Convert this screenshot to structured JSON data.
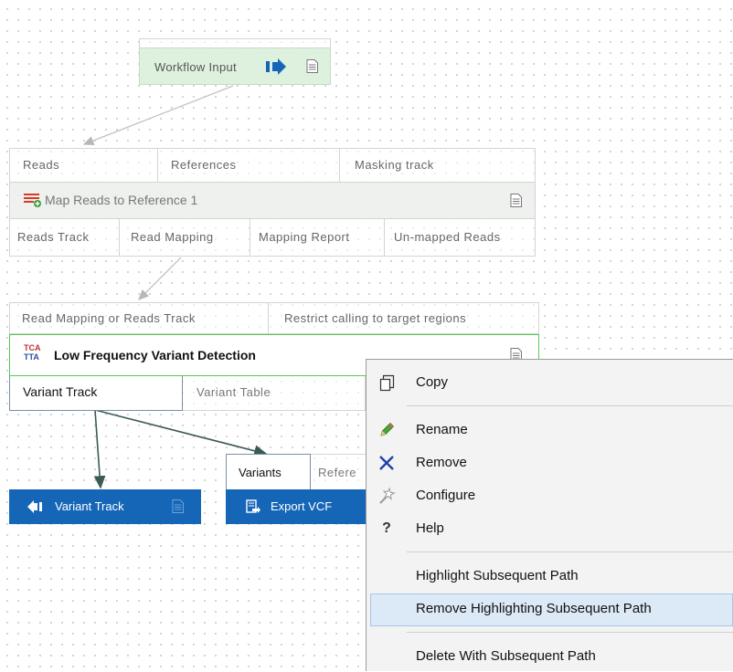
{
  "workflow_input": {
    "label": "Workflow Input"
  },
  "map_reads": {
    "input_ports": [
      "Reads",
      "References",
      "Masking track"
    ],
    "title": "Map Reads to Reference 1",
    "output_ports": [
      "Reads Track",
      "Read Mapping",
      "Mapping Report",
      "Un-mapped Reads"
    ]
  },
  "lfvd": {
    "input_ports": [
      "Read Mapping or Reads Track",
      "Restrict calling to target regions"
    ],
    "icon_text_top": "TCA",
    "icon_text_bottom": "TTA",
    "title": "Low Frequency Variant Detection",
    "output_ports": [
      "Variant Track",
      "Variant Table"
    ]
  },
  "output_node": {
    "label": "Variant Track"
  },
  "export_vcf": {
    "input_ports": [
      "Variants",
      "Refere"
    ],
    "label": "Export VCF"
  },
  "context_menu": {
    "items": [
      {
        "label": "Copy",
        "icon": "copy-icon"
      },
      {
        "label": "Rename",
        "icon": "pencil-icon"
      },
      {
        "label": "Remove",
        "icon": "x-icon"
      },
      {
        "label": "Configure",
        "icon": "wand-icon"
      },
      {
        "label": "Help",
        "icon": "question-icon"
      },
      {
        "label": "Highlight Subsequent Path",
        "icon": ""
      },
      {
        "label": "Remove Highlighting Subsequent Path",
        "icon": "",
        "hovered": true
      },
      {
        "label": "Delete With Subsequent Path",
        "icon": ""
      }
    ]
  },
  "colors": {
    "node_blue": "#1666b8",
    "workflow_input_green": "#daf0da",
    "lfvd_border": "#55c955",
    "arrow_dark": "#3b5a55",
    "menu_hover": "#dce9f7"
  }
}
